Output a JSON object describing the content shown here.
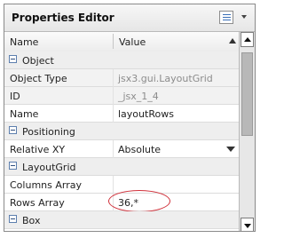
{
  "title": "Properties Editor",
  "header": {
    "name_label": "Name",
    "value_label": "Value"
  },
  "rows": [
    {
      "type": "group",
      "name": "Object"
    },
    {
      "type": "prop",
      "name": "Object Type",
      "value": "jsx3.gui.LayoutGrid",
      "readonly": true
    },
    {
      "type": "prop",
      "name": "ID",
      "value": "_jsx_1_4",
      "readonly": true
    },
    {
      "type": "prop",
      "name": "Name",
      "value": "layoutRows",
      "readonly": false
    },
    {
      "type": "group",
      "name": "Positioning"
    },
    {
      "type": "prop",
      "name": "Relative XY",
      "value": "Absolute",
      "readonly": false,
      "dropdown": true
    },
    {
      "type": "group",
      "name": "LayoutGrid"
    },
    {
      "type": "prop",
      "name": "Columns Array",
      "value": "",
      "readonly": false
    },
    {
      "type": "prop",
      "name": "Rows Array",
      "value": "36,*",
      "readonly": false,
      "highlighted": true
    },
    {
      "type": "group",
      "name": "Box"
    }
  ],
  "colors": {
    "highlight_circle": "#d0303a",
    "group_bg": "#eeeeee"
  },
  "icons": {
    "menu": "list-menu-icon",
    "sort": "sort-asc-icon",
    "toggle": "collapse-minus-icon"
  }
}
